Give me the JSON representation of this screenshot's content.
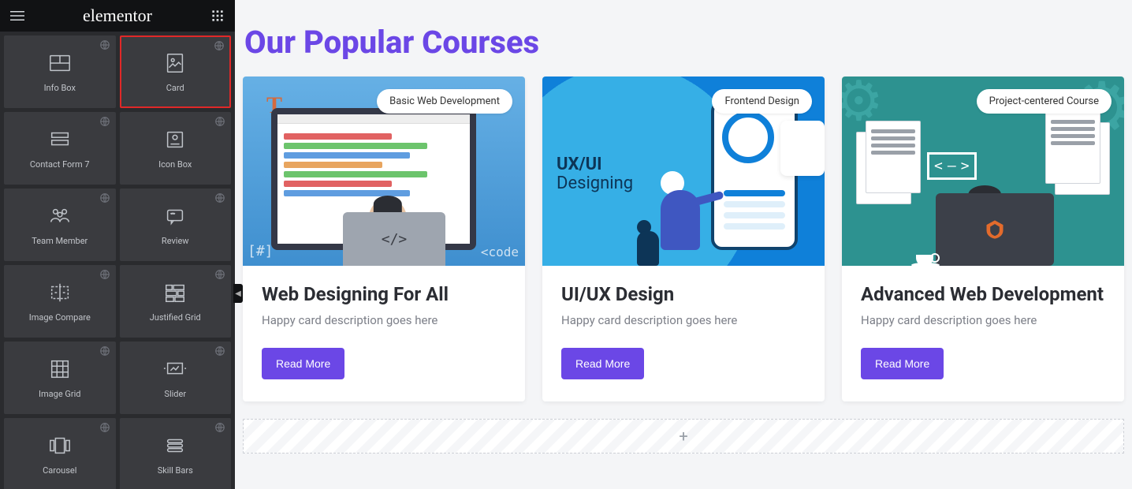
{
  "header": {
    "brand": "elementor"
  },
  "sidebar": {
    "widgets": [
      {
        "label": "Info Box"
      },
      {
        "label": "Card"
      },
      {
        "label": "Contact Form 7"
      },
      {
        "label": "Icon Box"
      },
      {
        "label": "Team Member"
      },
      {
        "label": "Review"
      },
      {
        "label": "Image Compare"
      },
      {
        "label": "Justified Grid"
      },
      {
        "label": "Image Grid"
      },
      {
        "label": "Slider"
      },
      {
        "label": "Carousel"
      },
      {
        "label": "Skill Bars"
      }
    ]
  },
  "page": {
    "title": "Our Popular Courses"
  },
  "cards": [
    {
      "badge": "Basic Web Development",
      "title": "Web Designing For All",
      "desc": "Happy card description goes here",
      "cta": "Read More",
      "t_text": "T",
      "code_text": "</>",
      "right_text": "<code",
      "hash_text": "[#]"
    },
    {
      "badge": "Frontend Design",
      "title": "UI/UX Design",
      "desc": "Happy card description goes here",
      "cta": "Read More",
      "ux_top": "UX/UI",
      "ux_bottom": "Designing"
    },
    {
      "badge": "Project-centered Course",
      "title": "Advanced Web Development",
      "desc": "Happy card description goes here",
      "cta": "Read More",
      "arrows_l": "<",
      "arrows_m": "—",
      "arrows_r": ">"
    }
  ],
  "add_section_glyph": "+"
}
